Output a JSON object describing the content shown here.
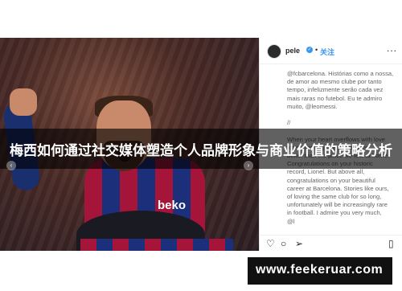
{
  "article": {
    "title": "梅西如何通过社交媒体塑造个人品牌形象与商业价值的策略分析"
  },
  "photo": {
    "jersey_sponsor": "beko",
    "nav_prev_icon": "chevron-left-icon",
    "nav_next_icon": "chevron-right-icon"
  },
  "instagram": {
    "username": "pele",
    "verified_icon": "verified-badge-icon",
    "separator": "•",
    "follow_label": "关注",
    "more_label": "...",
    "caption": "@fcbarcelona. Histórias como a nossa,\nde amor ao mesmo clube por tanto\ntempo, infelizmente serão cada vez\nmais raras no futebol. Eu te admiro\nmuito, @leomessi.\n\n//\n\nWhen your heart overflows with love\nfor something, there is nothing\nbetter than the place we feel at home.\nCongratulations on your historic\nrecord, Lionel. But above all,\ncongratulations on your beautiful\ncareer at Barcelona. Stories like ours,\nof loving the same club for so long,\nunfortunately will be increasingly rare\nin football. I admire you very much,\n@l",
    "actions": [
      "heart-icon",
      "comment-icon",
      "share-icon",
      "bookmark-icon"
    ]
  },
  "watermark": {
    "text": "www.feekeruar.com"
  },
  "colors": {
    "banner_bg": "#000000",
    "follow_blue": "#3897f0",
    "watermark_bg": "#111111"
  }
}
